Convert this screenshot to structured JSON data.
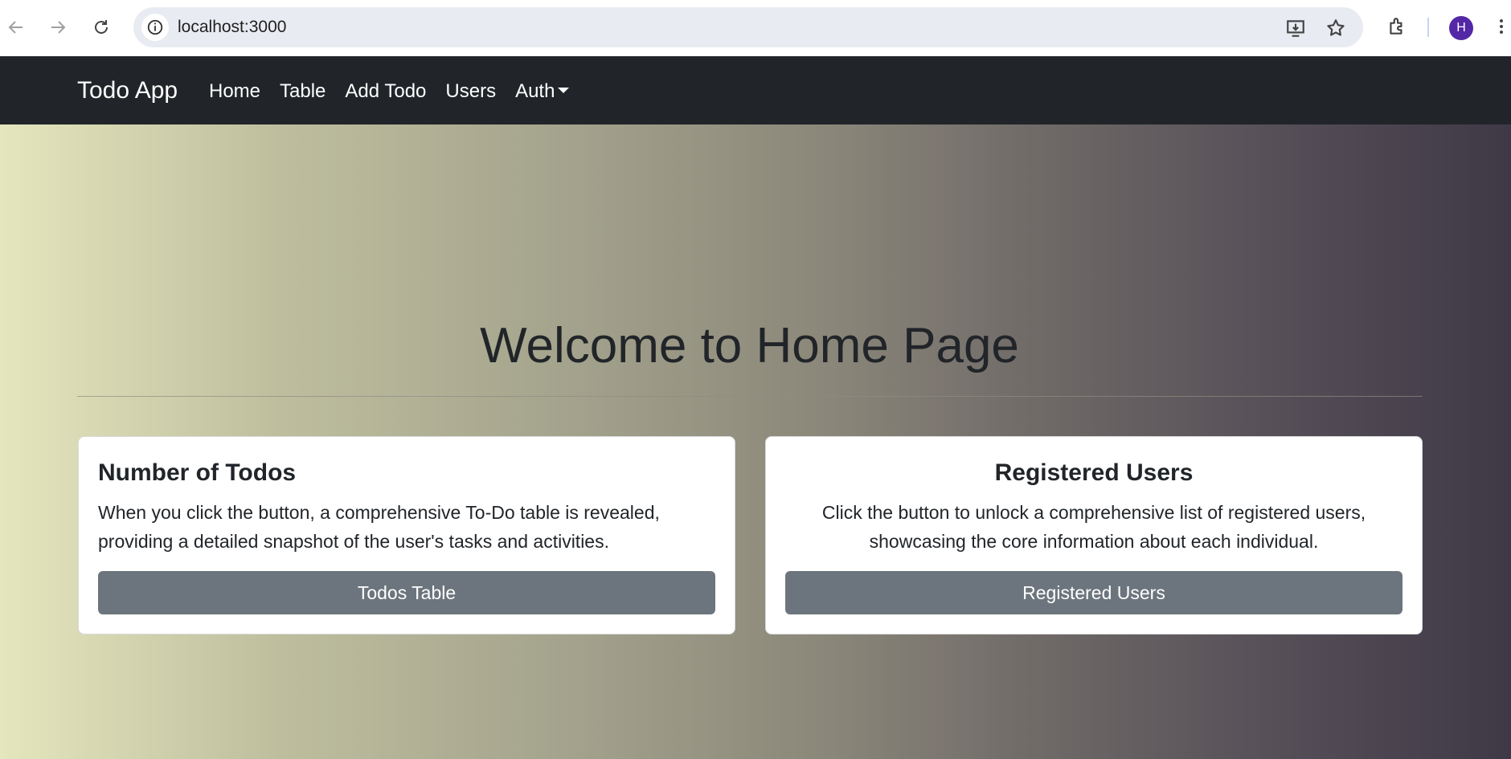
{
  "browser": {
    "url": "localhost:3000",
    "profile_initial": "H",
    "icons": [
      "back-arrow-icon",
      "forward-arrow-icon",
      "reload-icon",
      "site-info-icon",
      "install-app-icon",
      "bookmark-star-icon",
      "extensions-icon",
      "more-menu-icon"
    ]
  },
  "navbar": {
    "brand": "Todo App",
    "links": [
      "Home",
      "Table",
      "Add Todo",
      "Users",
      "Auth"
    ]
  },
  "main": {
    "title": "Welcome to Home Page",
    "cards": [
      {
        "title": "Number of Todos",
        "text": "When you click the button, a comprehensive To-Do table is revealed, providing a detailed snapshot of the user's tasks and activities.",
        "button": "Todos Table"
      },
      {
        "title": "Registered Users",
        "text": "Click the button to unlock a comprehensive list of registered users, showcasing the core information about each individual.",
        "button": "Registered Users"
      }
    ]
  },
  "colors": {
    "navbar_bg": "#212529",
    "button_bg": "#6c757d",
    "gradient_start": "#e5e6bd",
    "gradient_end": "#3f3947",
    "avatar_bg": "#5327a5"
  }
}
